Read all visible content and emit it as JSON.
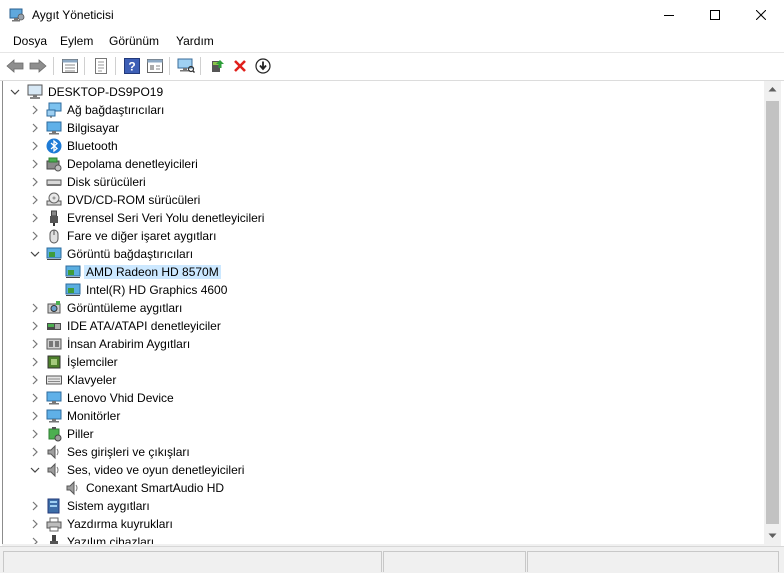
{
  "window": {
    "title": "Aygıt Yöneticisi"
  },
  "menu": [
    "Dosya",
    "Eylem",
    "Görünüm",
    "Yardım"
  ],
  "toolbar": [
    "back-icon",
    "forward-icon",
    "properties-grid-icon",
    "show-hidden-icon",
    "help-icon",
    "view-icon",
    "monitor-scan-icon",
    "update-driver-icon",
    "uninstall-icon",
    "disable-device-icon"
  ],
  "tree": {
    "root": "DESKTOP-DS9PO19",
    "items": [
      {
        "label": "Ağ bağdaştırıcıları",
        "icon": "network-adapter-icon",
        "state": "collapsed",
        "level": 1
      },
      {
        "label": "Bilgisayar",
        "icon": "computer-icon",
        "state": "collapsed",
        "level": 1
      },
      {
        "label": "Bluetooth",
        "icon": "bluetooth-icon",
        "state": "collapsed",
        "level": 1
      },
      {
        "label": "Depolama denetleyicileri",
        "icon": "storage-controller-icon",
        "state": "collapsed",
        "level": 1
      },
      {
        "label": "Disk sürücüleri",
        "icon": "disk-drive-icon",
        "state": "collapsed",
        "level": 1
      },
      {
        "label": "DVD/CD-ROM sürücüleri",
        "icon": "dvd-drive-icon",
        "state": "collapsed",
        "level": 1
      },
      {
        "label": "Evrensel Seri Veri Yolu denetleyicileri",
        "icon": "usb-icon",
        "state": "collapsed",
        "level": 1
      },
      {
        "label": "Fare ve diğer işaret aygıtları",
        "icon": "mouse-icon",
        "state": "collapsed",
        "level": 1
      },
      {
        "label": "Görüntü bağdaştırıcıları",
        "icon": "display-adapter-icon",
        "state": "expanded",
        "level": 1
      },
      {
        "label": "AMD Radeon HD 8570M",
        "icon": "display-adapter-icon",
        "state": "leaf",
        "level": 2,
        "selected": true
      },
      {
        "label": "Intel(R) HD Graphics 4600",
        "icon": "display-adapter-icon",
        "state": "leaf",
        "level": 2
      },
      {
        "label": "Görüntüleme aygıtları",
        "icon": "imaging-device-icon",
        "state": "collapsed",
        "level": 1
      },
      {
        "label": "IDE ATA/ATAPI denetleyiciler",
        "icon": "ide-controller-icon",
        "state": "collapsed",
        "level": 1
      },
      {
        "label": "İnsan Arabirim Aygıtları",
        "icon": "hid-icon",
        "state": "collapsed",
        "level": 1
      },
      {
        "label": "İşlemciler",
        "icon": "processor-icon",
        "state": "collapsed",
        "level": 1
      },
      {
        "label": "Klavyeler",
        "icon": "keyboard-icon",
        "state": "collapsed",
        "level": 1
      },
      {
        "label": "Lenovo Vhid Device",
        "icon": "monitor-icon",
        "state": "collapsed",
        "level": 1
      },
      {
        "label": "Monitörler",
        "icon": "monitor-icon",
        "state": "collapsed",
        "level": 1
      },
      {
        "label": "Piller",
        "icon": "battery-icon",
        "state": "collapsed",
        "level": 1
      },
      {
        "label": "Ses girişleri ve çıkışları",
        "icon": "speaker-icon",
        "state": "collapsed",
        "level": 1
      },
      {
        "label": "Ses, video ve oyun denetleyicileri",
        "icon": "speaker-icon",
        "state": "expanded",
        "level": 1
      },
      {
        "label": "Conexant SmartAudio HD",
        "icon": "speaker-icon",
        "state": "leaf",
        "level": 2
      },
      {
        "label": "Sistem aygıtları",
        "icon": "system-device-icon",
        "state": "collapsed",
        "level": 1
      },
      {
        "label": "Yazdırma kuyrukları",
        "icon": "printer-icon",
        "state": "collapsed",
        "level": 1
      },
      {
        "label": "Yazılım cihazları",
        "icon": "software-device-icon",
        "state": "collapsed",
        "level": 1
      }
    ]
  },
  "colors": {
    "selection": "#cce8ff",
    "accent": "#1e7bd6"
  }
}
